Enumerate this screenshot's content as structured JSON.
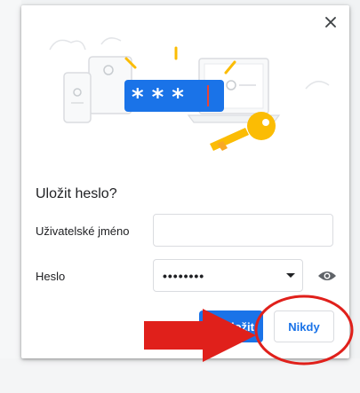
{
  "dialog": {
    "title": "Uložit heslo?",
    "username_label": "Uživatelské jméno",
    "username_value": "",
    "password_label": "Heslo",
    "password_masked": "••••••••",
    "save_label": "Uložit",
    "never_label": "Nikdy",
    "illustration_stars": "* * *"
  },
  "icons": {
    "close": "close-icon",
    "eye": "eye-icon",
    "caret": "chevron-down-icon",
    "key": "key-icon"
  },
  "colors": {
    "accent": "#1a73e8",
    "annotation_red": "#e0201b",
    "key_yellow": "#fbbc04",
    "password_cursor": "#ea4335"
  }
}
